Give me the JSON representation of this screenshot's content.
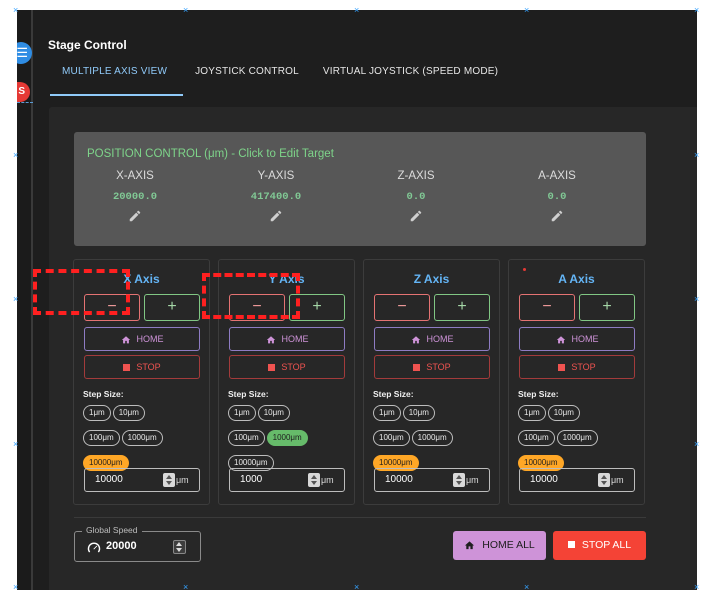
{
  "sidebar": {
    "menu_glyph": "☰",
    "badge_letter": "S"
  },
  "page_title": "Stage Control",
  "tabs": [
    {
      "label": "MULTIPLE AXIS VIEW",
      "active": true
    },
    {
      "label": "JOYSTICK CONTROL",
      "active": false
    },
    {
      "label": "VIRTUAL JOYSTICK (SPEED MODE)",
      "active": false
    }
  ],
  "position_control": {
    "title": "POSITION CONTROL (μm) - Click to Edit Target",
    "columns": [
      {
        "label": "X-AXIS",
        "value": "20000.0"
      },
      {
        "label": "Y-AXIS",
        "value": "417400.0"
      },
      {
        "label": "Z-AXIS",
        "value": "0.0"
      },
      {
        "label": "A-AXIS",
        "value": "0.0"
      }
    ]
  },
  "axes": [
    {
      "title": "X Axis",
      "minus": "−",
      "plus": "+",
      "home": "HOME",
      "stop": "STOP",
      "step_label": "Step Size:",
      "steps": [
        "1μm",
        "10μm",
        "100μm",
        "1000μm",
        "10000μm"
      ],
      "selected_step": "10000μm",
      "step_value": "10000",
      "unit": "μm"
    },
    {
      "title": "Y Axis",
      "minus": "−",
      "plus": "+",
      "home": "HOME",
      "stop": "STOP",
      "step_label": "Step Size:",
      "steps": [
        "1μm",
        "10μm",
        "100μm",
        "1000μm",
        "10000μm"
      ],
      "selected_step": "1000μm",
      "step_value": "1000",
      "unit": "μm"
    },
    {
      "title": "Z Axis",
      "minus": "−",
      "plus": "+",
      "home": "HOME",
      "stop": "STOP",
      "step_label": "Step Size:",
      "steps": [
        "1μm",
        "10μm",
        "100μm",
        "1000μm",
        "10000μm"
      ],
      "selected_step": "10000μm",
      "step_value": "10000",
      "unit": "μm"
    },
    {
      "title": "A Axis",
      "minus": "−",
      "plus": "+",
      "home": "HOME",
      "stop": "STOP",
      "step_label": "Step Size:",
      "steps": [
        "1μm",
        "10μm",
        "100μm",
        "1000μm",
        "10000μm"
      ],
      "selected_step": "10000μm",
      "step_value": "10000",
      "unit": "μm"
    }
  ],
  "global_speed": {
    "label": "Global Speed",
    "value": "20000"
  },
  "actions": {
    "home_all": "HOME ALL",
    "stop_all": "STOP ALL"
  },
  "colors": {
    "accent_blue": "#90caf9",
    "axis_title": "#64b5f6",
    "position_green": "#7ed48a",
    "home_purple": "#ce93d8",
    "stop_red": "#f44336",
    "step_selected_orange": "#ffa726",
    "step_selected_green": "#66bb6a"
  },
  "icons": {
    "edit": "pencil-icon",
    "home": "home-icon",
    "stop": "stop-square-icon",
    "speed": "speedometer-icon",
    "menu": "menu-icon"
  }
}
